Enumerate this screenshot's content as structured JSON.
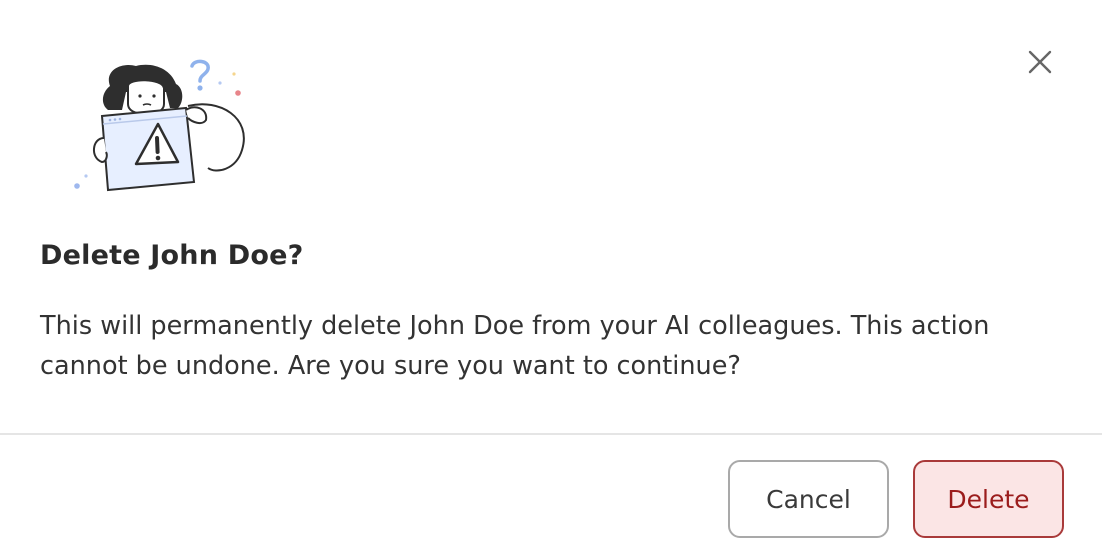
{
  "dialog": {
    "title": "Delete John Doe?",
    "message": "This will permanently delete John Doe from your AI colleagues. This action cannot be undone. Are you sure you want to continue?",
    "close_icon": "close-icon",
    "illustration_icon": "warning-illustration",
    "cancel_label": "Cancel",
    "delete_label": "Delete"
  },
  "colors": {
    "delete_text": "#9b1c1c",
    "delete_border": "#a93a3a",
    "delete_bg": "#fbe5e5",
    "cancel_border": "#a9a9a9"
  }
}
